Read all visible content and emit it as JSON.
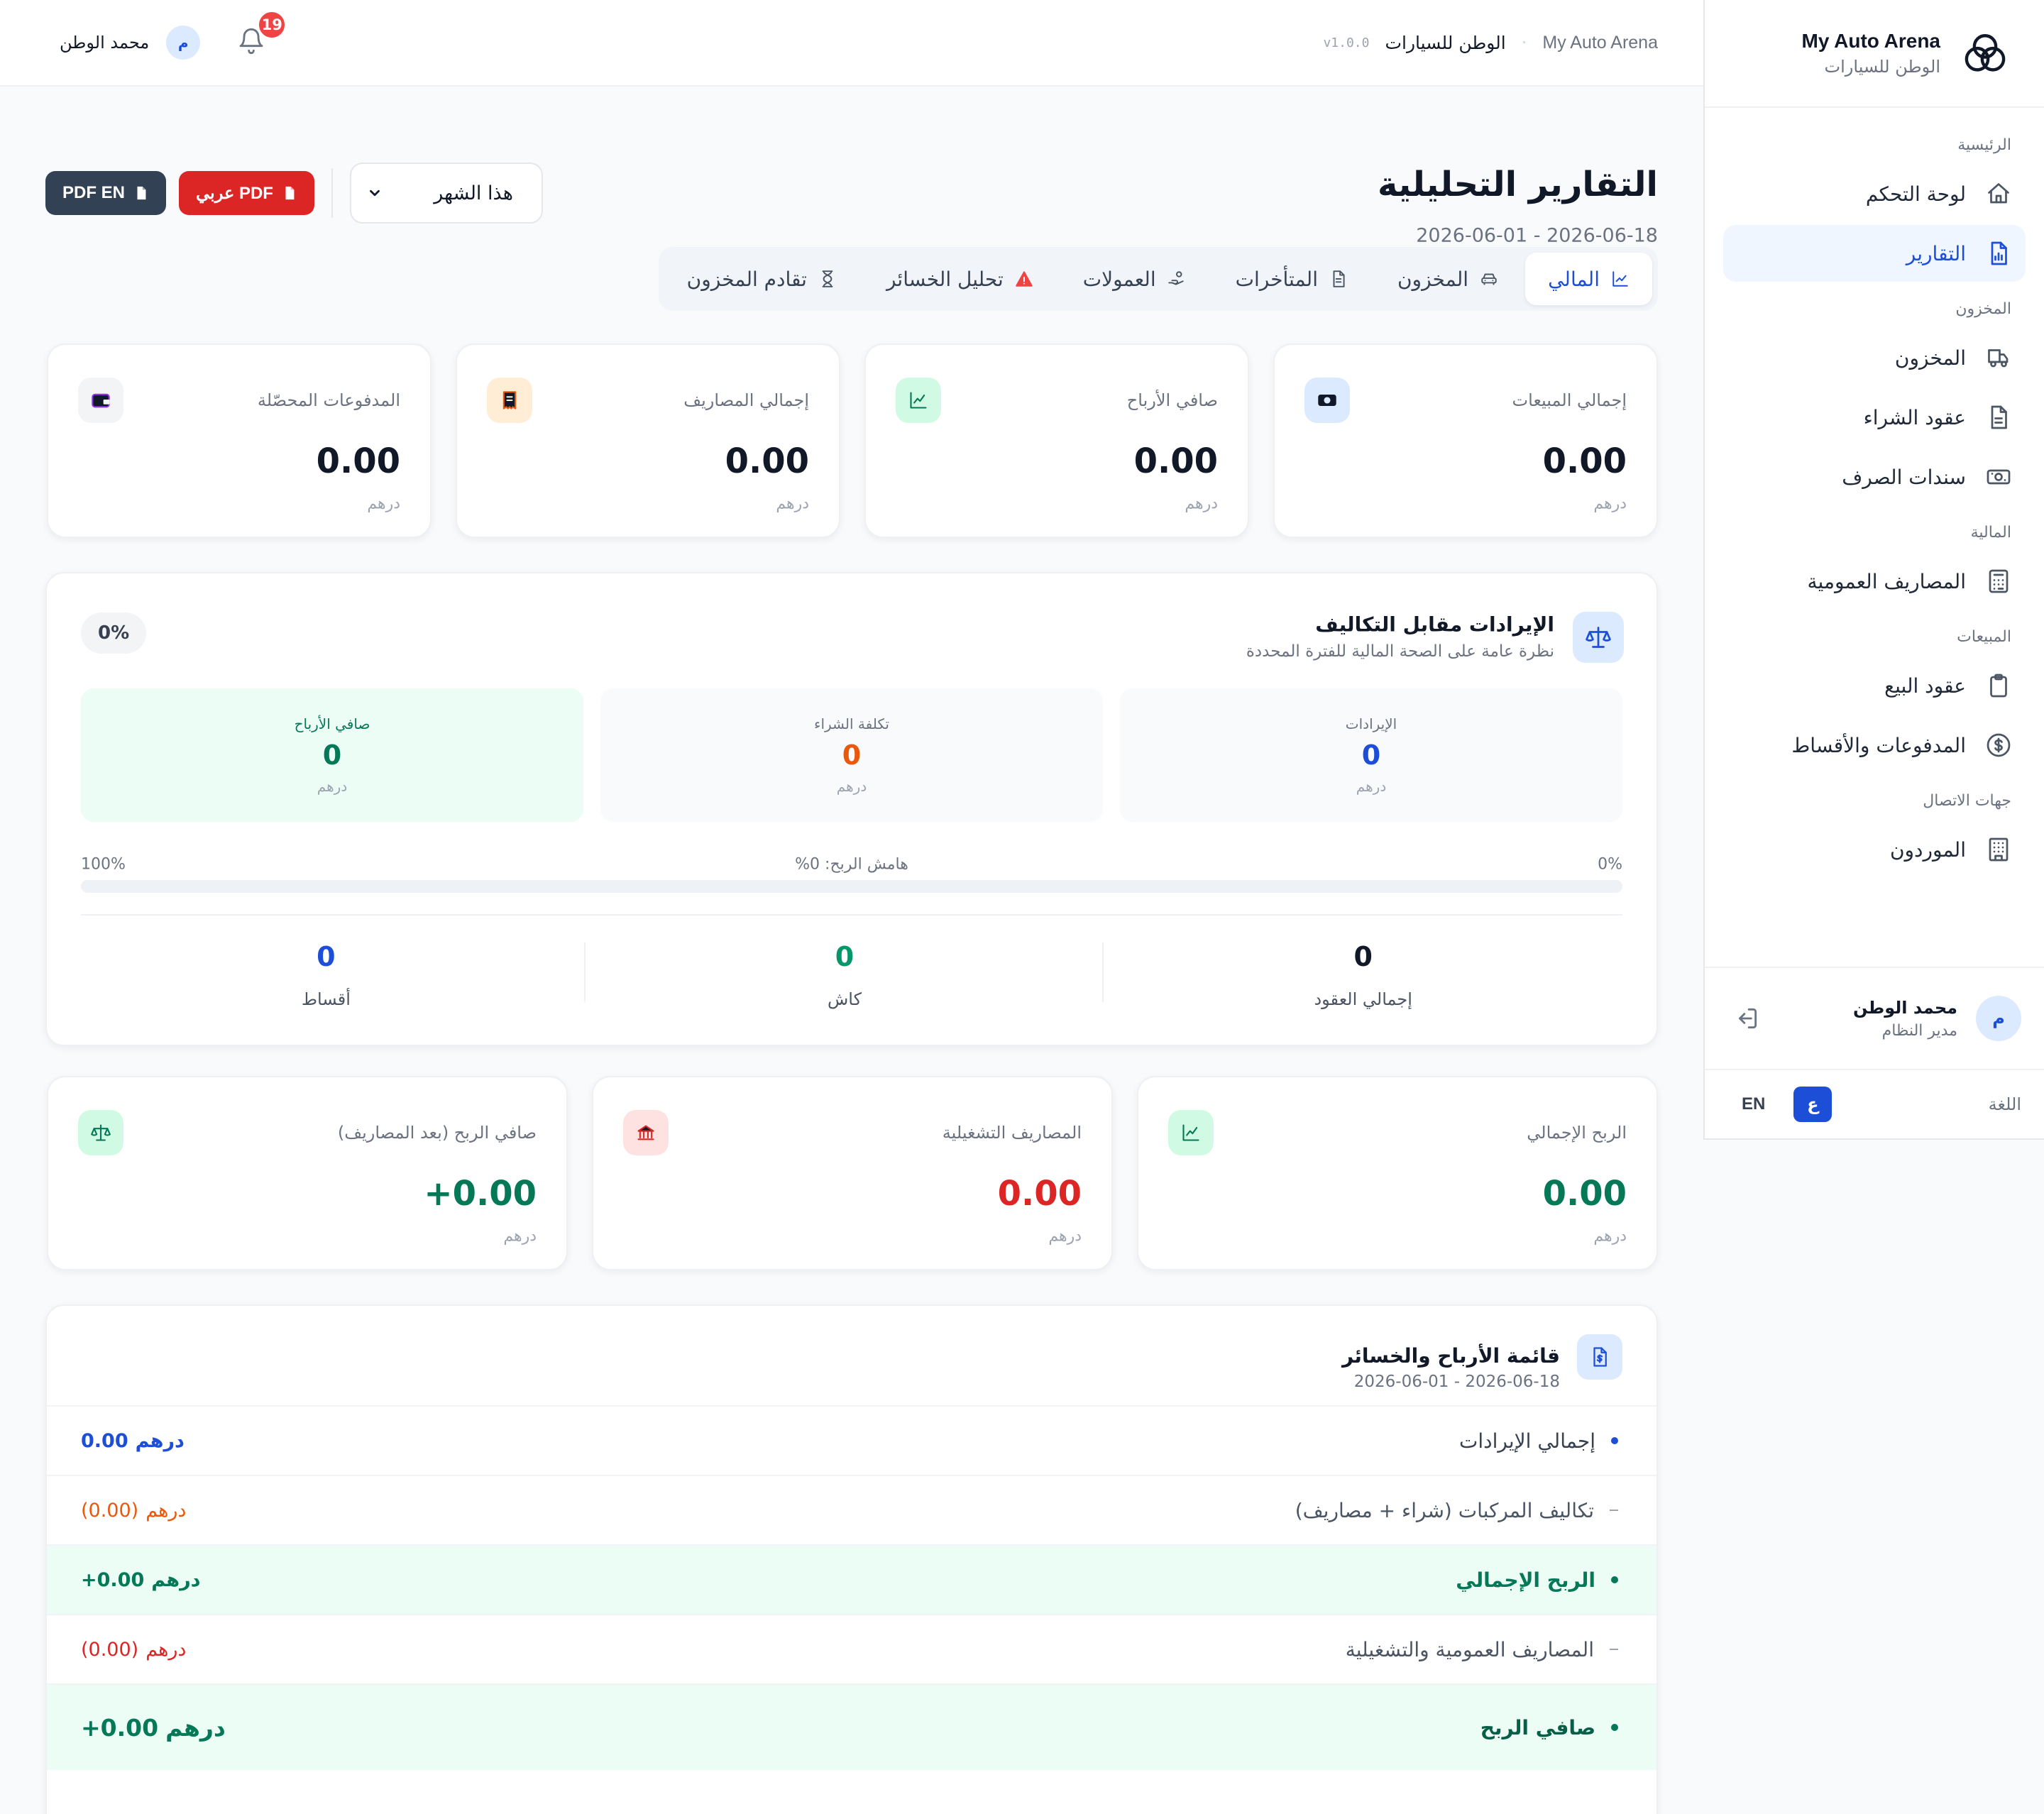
{
  "app": {
    "brand_name": "My Auto Arena",
    "brand_sub": "الوطن للسيارات"
  },
  "sidebar": {
    "sections": [
      {
        "title": "الرئيسية",
        "items": [
          {
            "label": "لوحة التحكم",
            "icon": "home-icon",
            "active": false
          },
          {
            "label": "التقارير",
            "icon": "report-icon",
            "active": true
          }
        ]
      },
      {
        "title": "المخزون",
        "items": [
          {
            "label": "المخزون",
            "icon": "truck-icon",
            "active": false
          },
          {
            "label": "عقود الشراء",
            "icon": "document-icon",
            "active": false
          },
          {
            "label": "سندات الصرف",
            "icon": "cash-icon",
            "active": false
          }
        ]
      },
      {
        "title": "المالية",
        "items": [
          {
            "label": "المصاريف العمومية",
            "icon": "calculator-icon",
            "active": false
          }
        ]
      },
      {
        "title": "المبيعات",
        "items": [
          {
            "label": "عقود البيع",
            "icon": "clipboard-icon",
            "active": false
          },
          {
            "label": "المدفوعات والأقساط",
            "icon": "dollar-icon",
            "active": false
          }
        ]
      },
      {
        "title": "جهات الاتصال",
        "items": [
          {
            "label": "الموردون",
            "icon": "building-icon",
            "active": false
          }
        ]
      }
    ],
    "user": {
      "initial": "م",
      "name": "محمد الوطن",
      "role": "مدير النظام"
    },
    "language": {
      "label": "اللغة",
      "arabic": "ع",
      "english": "EN"
    }
  },
  "topbar": {
    "crumb_en": "My Auto Arena",
    "crumb_ar": "الوطن للسيارات",
    "version": "v1.0.0",
    "notifications": "19",
    "user_initial": "م",
    "user_name": "محمد الوطن"
  },
  "page": {
    "title": "التقارير التحليلية",
    "date_range": "2026-06-18 - 2026-06-01",
    "period": "هذا الشهر",
    "pdf_ar": "PDF عربي",
    "pdf_en": "PDF EN"
  },
  "tabs": [
    {
      "label": "المالي",
      "icon": "chart-line-icon",
      "active": true
    },
    {
      "label": "المخزون",
      "icon": "car-icon",
      "active": false
    },
    {
      "label": "المتأخرات",
      "icon": "file-icon",
      "active": false
    },
    {
      "label": "العمولات",
      "icon": "hand-coin-icon",
      "active": false
    },
    {
      "label": "تحليل الخسائر",
      "icon": "warning-icon",
      "active": false
    },
    {
      "label": "تقادم المخزون",
      "icon": "hourglass-icon",
      "active": false
    }
  ],
  "stats": [
    {
      "label": "إجمالي المبيعات",
      "value": "0.00",
      "unit": "درهم",
      "icon": "money-icon",
      "icon_bg": "#dbeafe",
      "icon_color": "#1d4ed8"
    },
    {
      "label": "صافي الأرباح",
      "value": "0.00",
      "unit": "درهم",
      "icon": "trend-icon",
      "icon_bg": "#d1fae5",
      "icon_color": "#047857"
    },
    {
      "label": "إجمالي المصاريف",
      "value": "0.00",
      "unit": "درهم",
      "icon": "receipt-icon",
      "icon_bg": "#ffedd5",
      "icon_color": "#ea580c"
    },
    {
      "label": "المدفوعات المحصّلة",
      "value": "0.00",
      "unit": "درهم",
      "icon": "wallet-icon",
      "icon_bg": "#f3f4f6",
      "icon_color": "#9333ea"
    }
  ],
  "revenue_cost": {
    "title": "الإيرادات مقابل التكاليف",
    "subtitle": "نظرة عامة على الصحة المالية للفترة المحددة",
    "pill": "0%",
    "revenue": {
      "label": "الإيرادات",
      "value": "0",
      "unit": "درهم"
    },
    "cost": {
      "label": "تكلفة الشراء",
      "value": "0",
      "unit": "درهم"
    },
    "profit": {
      "label": "صافي الأرباح",
      "value": "0",
      "unit": "درهم"
    },
    "margin_label": "هامش الربح: 0%",
    "margin_min": "0%",
    "margin_max": "100%",
    "margin_fraction": 0,
    "totals": [
      {
        "label": "إجمالي العقود",
        "value": "0",
        "color": "#111827"
      },
      {
        "label": "كاش",
        "value": "0",
        "color": "#059669"
      },
      {
        "label": "أقساط",
        "value": "0",
        "color": "#1d4ed8"
      }
    ]
  },
  "profit_cards": [
    {
      "label": "الربح الإجمالي",
      "value": "0.00",
      "unit": "درهم",
      "value_color": "#047857",
      "icon": "trend-icon",
      "icon_bg": "#d1fae5",
      "icon_color": "#047857"
    },
    {
      "label": "المصاريف التشغيلية",
      "value": "0.00",
      "unit": "درهم",
      "value_color": "#dc2626",
      "icon": "bank-icon",
      "icon_bg": "#fee2e2",
      "icon_color": "#dc2626"
    },
    {
      "label": "صافي الربح (بعد المصاريف)",
      "value": "+0.00",
      "unit": "درهم",
      "value_color": "#047857",
      "icon": "scale-icon",
      "icon_bg": "#d1fae5",
      "icon_color": "#047857"
    }
  ],
  "pl": {
    "title": "قائمة الأرباح والخسائر",
    "range": "2026-06-18 - 2026-06-01",
    "rows": [
      {
        "label": "إجمالي الإيرادات",
        "amount": "0.00",
        "currency": "درهم",
        "kind": "bullet",
        "color": "#1d4ed8",
        "label_color": "#374151",
        "bold": false,
        "hl": false
      },
      {
        "label": "تكاليف المركبات (شراء + مصاريف)",
        "amount": "(0.00)",
        "currency": "درهم",
        "kind": "dash",
        "color": "#ea580c",
        "label_color": "#4b5563",
        "bold": false,
        "hl": false
      },
      {
        "label": "الربح الإجمالي",
        "amount": "+0.00",
        "currency": "درهم",
        "kind": "bullet",
        "color": "#047857",
        "label_color": "#047857",
        "bold": true,
        "hl": true
      },
      {
        "label": "المصاريف العمومية والتشغيلية",
        "amount": "(0.00)",
        "currency": "درهم",
        "kind": "dash",
        "color": "#dc2626",
        "label_color": "#4b5563",
        "bold": false,
        "hl": false
      },
      {
        "label": "صافي الربح",
        "amount": "+0.00",
        "currency": "درهم",
        "kind": "bullet",
        "color": "#047857",
        "label_color": "#065f46",
        "bold": true,
        "hl": true
      }
    ]
  }
}
